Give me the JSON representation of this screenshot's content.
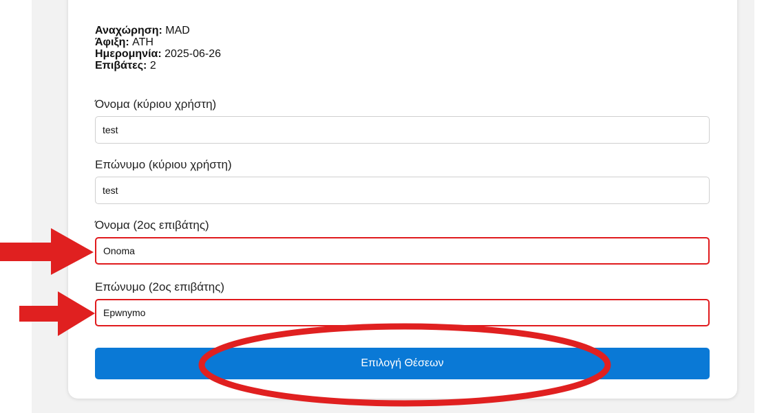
{
  "summary": {
    "departure_label": "Αναχώρηση:",
    "departure_value": "MAD",
    "arrival_label": "Άφιξη:",
    "arrival_value": "ATH",
    "date_label": "Ημερομηνία:",
    "date_value": "2025-06-26",
    "passengers_label": "Επιβάτες:",
    "passengers_value": "2"
  },
  "form": {
    "first_name_main_label": "Όνομα (κύριου χρήστη)",
    "first_name_main_value": "test",
    "last_name_main_label": "Επώνυμο (κύριου χρήστη)",
    "last_name_main_value": "test",
    "first_name_second_label": "Όνομα (2ος επιβάτης)",
    "first_name_second_value": "Onoma",
    "last_name_second_label": "Επώνυμο (2ος επιβάτης)",
    "last_name_second_value": "Epwnymo"
  },
  "actions": {
    "select_seats_label": "Επιλογή Θέσεων"
  },
  "annotations": {
    "highlight_color": "#e0191c",
    "arrow_icon": "arrow-right-icon",
    "ellipse_icon": "highlight-ellipse"
  },
  "theme": {
    "accent": "#0a79d6",
    "invalid_border": "#e0191c"
  }
}
